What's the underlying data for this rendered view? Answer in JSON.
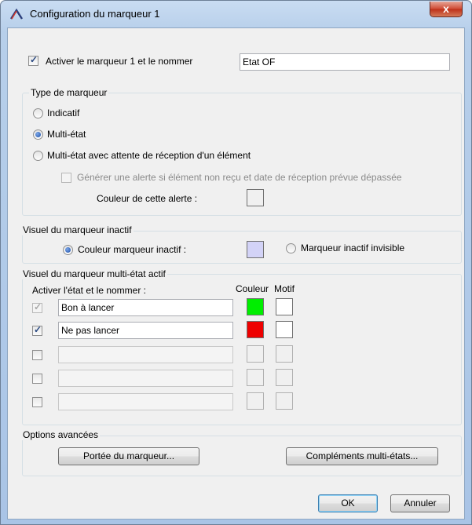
{
  "window": {
    "title": "Configuration du marqueur 1",
    "close_label": "x"
  },
  "activate": {
    "checked": true,
    "label": "Activer le marqueur 1 et le nommer",
    "name_value": "Etat OF"
  },
  "type_group": {
    "title": "Type de marqueur",
    "options": [
      "Indicatif",
      "Multi-état",
      "Multi-état avec attente de réception d'un élément"
    ],
    "selected": "Multi-état",
    "alert_checkbox_label": "Générer une alerte si élément non reçu et date de réception prévue dépassée",
    "alert_color_label": "Couleur de cette alerte :"
  },
  "inactive_group": {
    "title": "Visuel du marqueur inactif",
    "color_option": "Couleur marqueur inactif :",
    "color_value": "#d3d3f7",
    "invisible_option": "Marqueur inactif invisible",
    "selected": "Couleur marqueur inactif :"
  },
  "multistate_group": {
    "title": "Visuel du marqueur multi-état actif",
    "col_activate": "Activer l'état et le nommer :",
    "col_color": "Couleur",
    "col_motif": "Motif",
    "rows": [
      {
        "checked": true,
        "disabled": true,
        "name": "Bon à lancer",
        "color": "#00ee00",
        "enabled": true
      },
      {
        "checked": true,
        "disabled": false,
        "name": "Ne pas lancer",
        "color": "#ee0000",
        "enabled": true
      },
      {
        "checked": false,
        "disabled": false,
        "name": "",
        "color": "",
        "enabled": false
      },
      {
        "checked": false,
        "disabled": false,
        "name": "",
        "color": "",
        "enabled": false
      },
      {
        "checked": false,
        "disabled": false,
        "name": "",
        "color": "",
        "enabled": false
      }
    ]
  },
  "advanced_group": {
    "title": "Options avancées",
    "scope_button": "Portée du marqueur...",
    "complements_button": "Compléments multi-états..."
  },
  "footer": {
    "ok": "OK",
    "cancel": "Annuler"
  }
}
